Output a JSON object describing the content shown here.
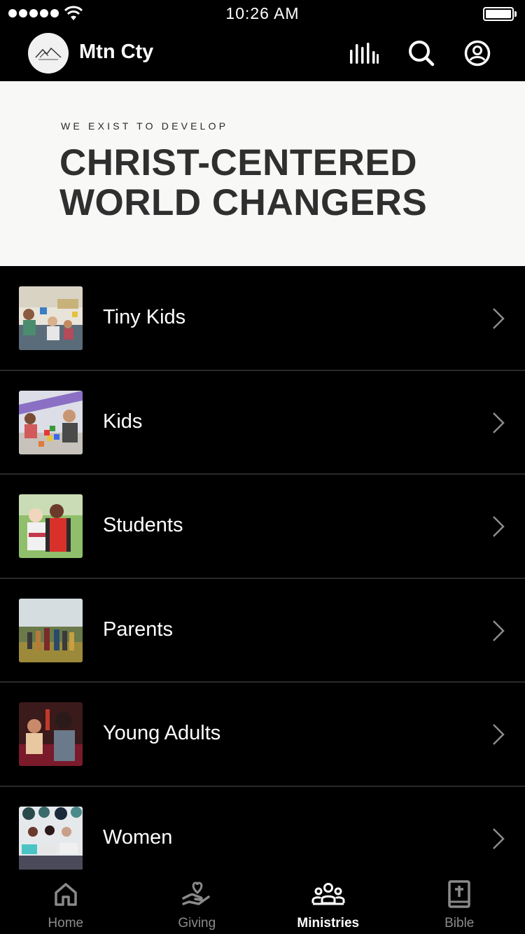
{
  "status_bar": {
    "time": "10:26 AM"
  },
  "header": {
    "title": "Mtn Cty"
  },
  "banner": {
    "subtitle": "WE EXIST TO DEVELOP",
    "title_line1": "CHRIST-CENTERED",
    "title_line2": "WORLD CHANGERS"
  },
  "ministries": [
    {
      "label": "Tiny Kids"
    },
    {
      "label": "Kids"
    },
    {
      "label": "Students"
    },
    {
      "label": "Parents"
    },
    {
      "label": "Young Adults"
    },
    {
      "label": "Women"
    }
  ],
  "tabs": [
    {
      "label": "Home",
      "icon": "home-icon"
    },
    {
      "label": "Giving",
      "icon": "giving-icon"
    },
    {
      "label": "Ministries",
      "icon": "ministries-icon",
      "active": true
    },
    {
      "label": "Bible",
      "icon": "bible-icon"
    }
  ],
  "colors": {
    "background": "#000000",
    "banner_bg": "#f8f8f7",
    "banner_text": "#2f2f2f",
    "inactive_tab": "#8a8a8a",
    "active_tab": "#ffffff"
  }
}
